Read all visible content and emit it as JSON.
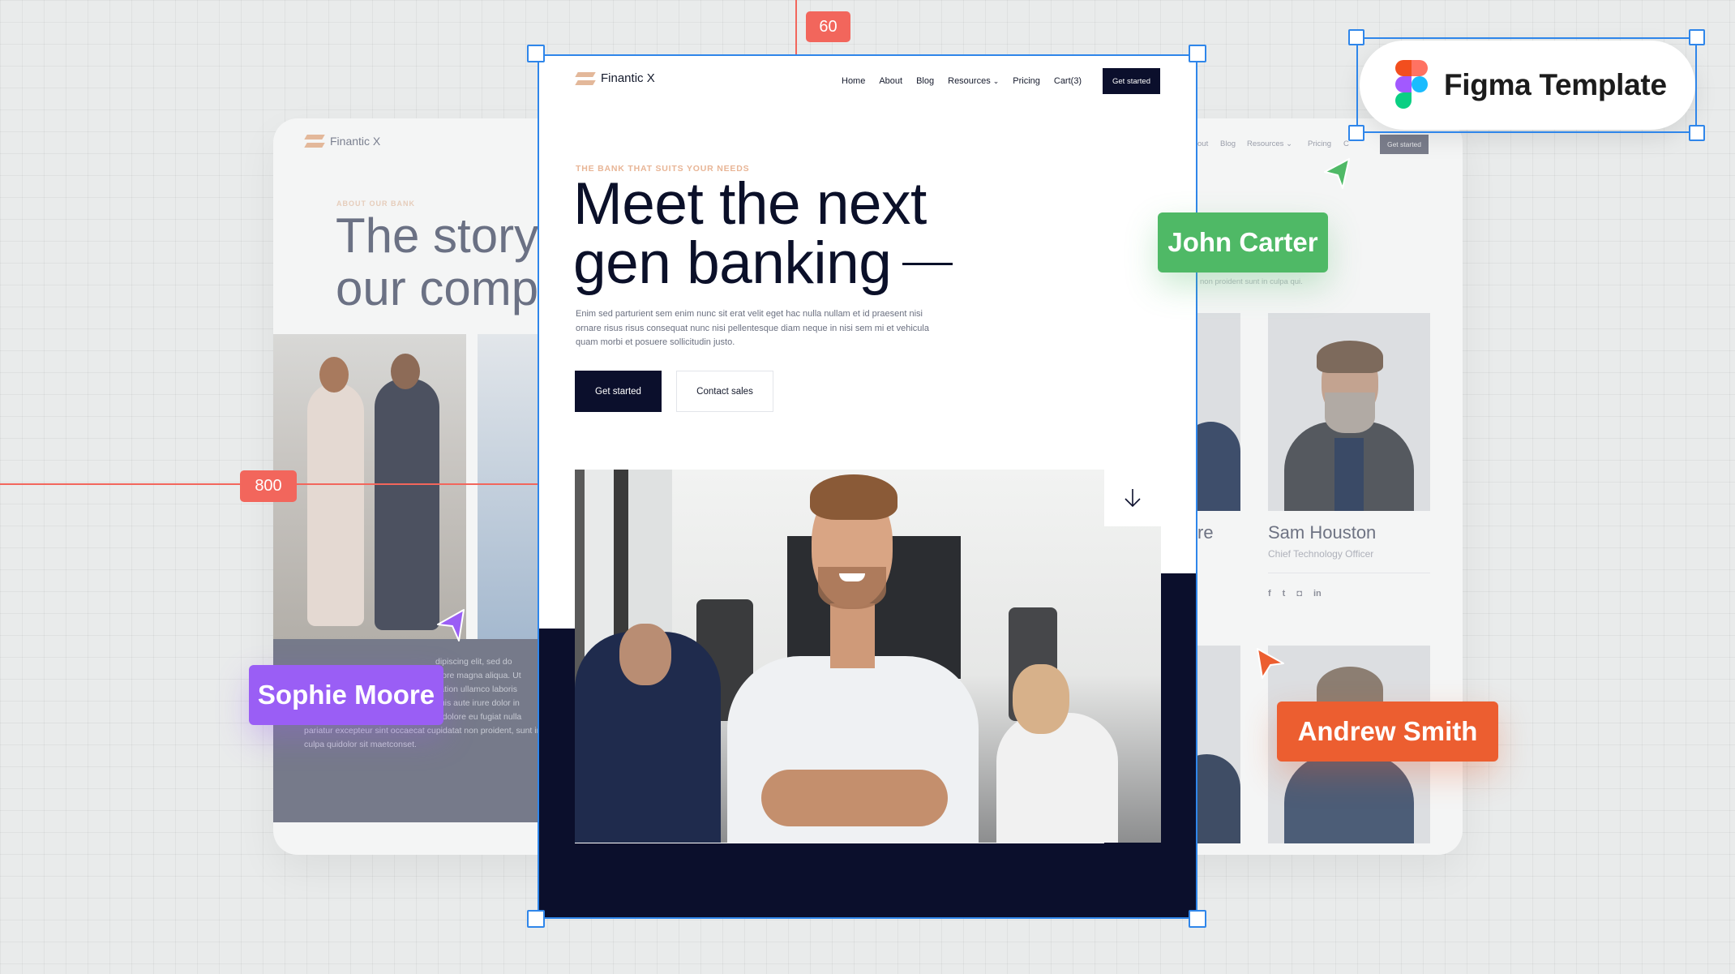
{
  "canvas": {
    "guides": {
      "top_measure": "60",
      "left_measure": "800"
    },
    "colors": {
      "selection": "#2f86ea",
      "guide": "#f2665c",
      "navy": "#0b0f2c",
      "accent_peach": "#e8b596"
    }
  },
  "figma_badge": {
    "icon": "figma-logo-icon",
    "label": "Figma Template"
  },
  "collaborators": [
    {
      "name": "John Carter",
      "color": "#4fb966",
      "icon": "cursor-arrow-icon"
    },
    {
      "name": "Sophie Moore",
      "color": "#9a5ef5",
      "icon": "cursor-arrow-icon"
    },
    {
      "name": "Andrew Smith",
      "color": "#ec5e30",
      "icon": "cursor-arrow-icon"
    }
  ],
  "main_page": {
    "brand": "Finantic X",
    "nav": {
      "links": [
        "Home",
        "About",
        "Blog",
        "Resources",
        "Pricing",
        "Cart(3)"
      ],
      "resources_icon": "chevron-down-icon",
      "cta": "Get started"
    },
    "hero": {
      "eyebrow": "THE BANK THAT SUITS YOUR NEEDS",
      "title_line1": "Meet the next",
      "title_line2": "gen banking",
      "body": "Enim sed parturient sem enim nunc sit erat velit eget hac nulla nullam et id praesent nisi ornare risus risus consequat nunc nisi pellentesque diam neque in nisi sem mi et vehicula quam morbi et posuere sollicitudin justo.",
      "primary_button": "Get started",
      "secondary_button": "Contact sales",
      "scroll_icon": "arrow-down-icon"
    }
  },
  "left_card": {
    "brand": "Finantic X",
    "eyebrow": "ABOUT OUR BANK",
    "title_line1": "The story",
    "title_line2": "our comp",
    "body_lines": [
      "dipiscing elit, sed do",
      "olore magna aliqua. Ut",
      "itation ullamco laboris",
      "duis aute irure dolor in",
      "n dolore eu fugiat nulla",
      "pariatur excepteur sint occaecat cupidatat non proident, sunt in",
      "culpa quidolor sit maetconset."
    ]
  },
  "right_card": {
    "nav": {
      "links": [
        "out",
        "Blog",
        "Resources",
        "Pricing",
        "C"
      ],
      "cta": "Get started"
    },
    "subtitle_fragment": "non proident sunt in culpa qui.",
    "team": [
      {
        "name_fragment": "re"
      },
      {
        "name": "Sam Houston",
        "role": "Chief Technology Officer"
      }
    ],
    "social_icons": [
      "facebook-icon",
      "twitter-icon",
      "instagram-icon",
      "linkedin-icon"
    ],
    "social_glyphs": [
      "f",
      "t",
      "◘",
      "in"
    ]
  }
}
